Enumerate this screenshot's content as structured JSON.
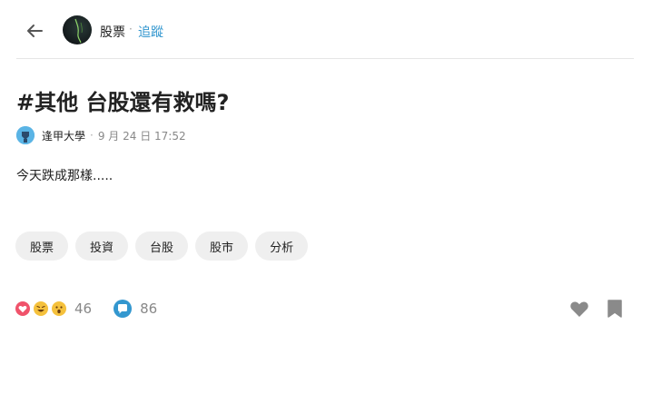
{
  "header": {
    "board_name": "股票",
    "separator": "·",
    "follow_label": "追蹤"
  },
  "post": {
    "title": "#其他 台股還有救嗎?",
    "author": "逢甲大學",
    "separator": "·",
    "timestamp": "9 月 24 日 17:52",
    "body": "今天跌成那樣.....",
    "tags": [
      "股票",
      "投資",
      "台股",
      "股市",
      "分析"
    ]
  },
  "stats": {
    "reaction_count": "46",
    "comment_count": "86",
    "reaction_icons": [
      "heart-reaction-icon",
      "laugh-reaction-icon",
      "surprised-reaction-icon"
    ]
  },
  "colors": {
    "accent": "#3397cf",
    "heart_reaction": "#f0536b",
    "emoji_yellow": "#f5c13c",
    "comment": "#3397cf",
    "muted": "#888888",
    "tag_bg": "#efefef"
  }
}
